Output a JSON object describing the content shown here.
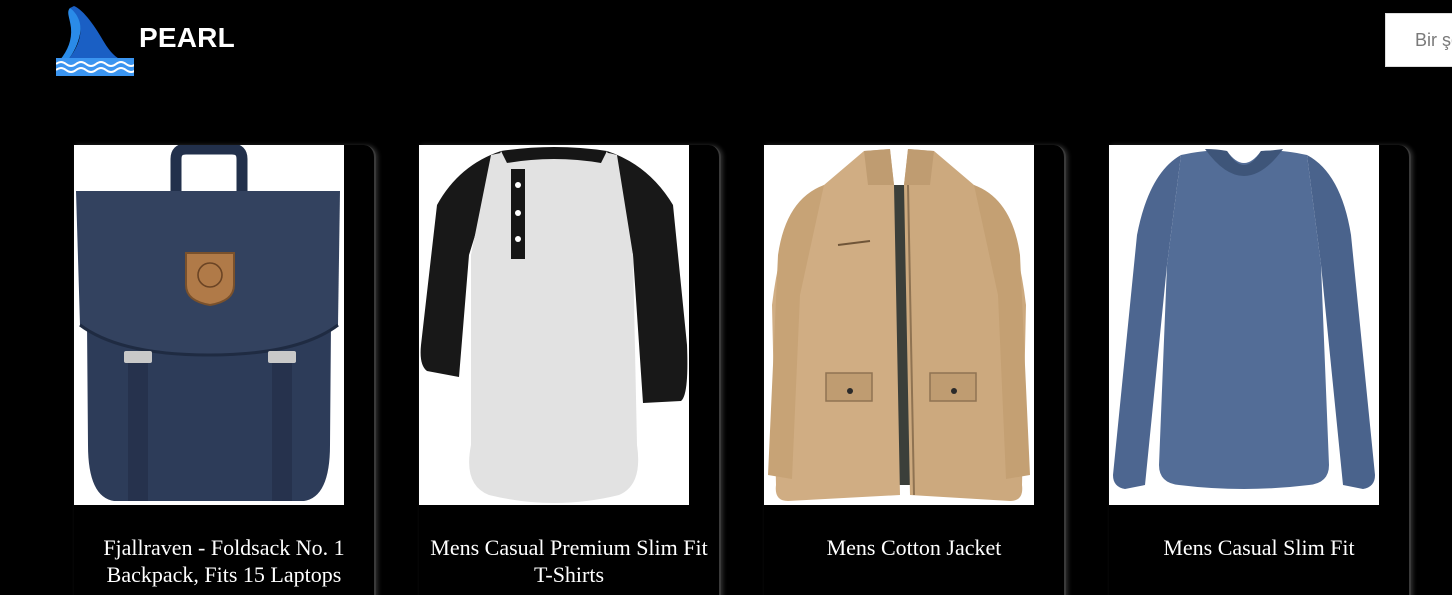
{
  "header": {
    "brand_name": "PEARL",
    "search_placeholder": "Bir şey ara..."
  },
  "products": [
    {
      "title": "Fjallraven - Foldsack No. 1 Backpack, Fits 15 Laptops",
      "image": "navy-backpack-image"
    },
    {
      "title": "Mens Casual Premium Slim Fit T-Shirts",
      "image": "raglan-henley-shirt-image"
    },
    {
      "title": "Mens Cotton Jacket",
      "image": "khaki-cotton-jacket-image"
    },
    {
      "title": "Mens Casual Slim Fit",
      "image": "blue-long-sleeve-shirt-image"
    }
  ],
  "colors": {
    "background": "#000000",
    "text": "#ffffff",
    "logo_blue": "#1e6fd0",
    "backpack_navy": "#2b3a57",
    "jacket_khaki": "#d0b087",
    "shirt_blue": "#4f6891"
  }
}
